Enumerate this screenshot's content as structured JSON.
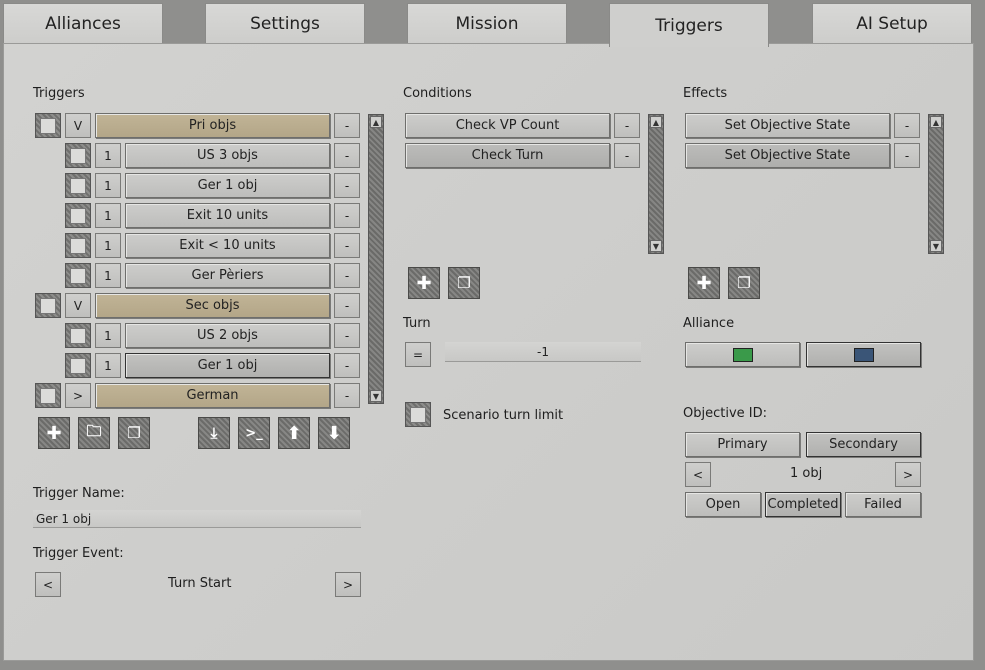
{
  "tabs": [
    "Alliances",
    "Settings",
    "Mission",
    "Triggers",
    "AI Setup"
  ],
  "triggers": {
    "header": "Triggers",
    "rows": [
      {
        "toggle": "V",
        "name": "Pri objs",
        "del": "-"
      },
      {
        "toggle": "1",
        "name": "US 3 objs",
        "del": "-"
      },
      {
        "toggle": "1",
        "name": "Ger 1 obj",
        "del": "-"
      },
      {
        "toggle": "1",
        "name": "Exit 10 units",
        "del": "-"
      },
      {
        "toggle": "1",
        "name": "Exit < 10 units",
        "del": "-"
      },
      {
        "toggle": "1",
        "name": "Ger Pèriers",
        "del": "-"
      },
      {
        "toggle": "V",
        "name": "Sec objs",
        "del": "-"
      },
      {
        "toggle": "1",
        "name": "US 2 objs",
        "del": "-"
      },
      {
        "toggle": "1",
        "name": "Ger 1 obj",
        "del": "-"
      },
      {
        "toggle": ">",
        "name": "German",
        "del": "-"
      }
    ]
  },
  "conditions": {
    "header": "Conditions",
    "items": [
      "Check VP Count",
      "Check Turn"
    ],
    "del": "-"
  },
  "effects": {
    "header": "Effects",
    "items": [
      "Set Objective State",
      "Set Objective State"
    ],
    "del": "-"
  },
  "turn": {
    "label": "Turn",
    "operator": "=",
    "value": "-1",
    "limit_label": "Scenario turn limit"
  },
  "alliance": {
    "label": "Alliance",
    "color1": "#3a9a4a",
    "color2": "#3a5577"
  },
  "objective": {
    "label": "Objective ID:",
    "primary": "Primary",
    "secondary": "Secondary",
    "prev": "<",
    "value": "1 obj",
    "next": ">",
    "open": "Open",
    "completed": "Completed",
    "failed": "Failed"
  },
  "trigger_name": {
    "label": "Trigger Name:",
    "value": "Ger 1 obj"
  },
  "trigger_event": {
    "label": "Trigger Event:",
    "prev": "<",
    "value": "Turn Start",
    "next": ">"
  }
}
